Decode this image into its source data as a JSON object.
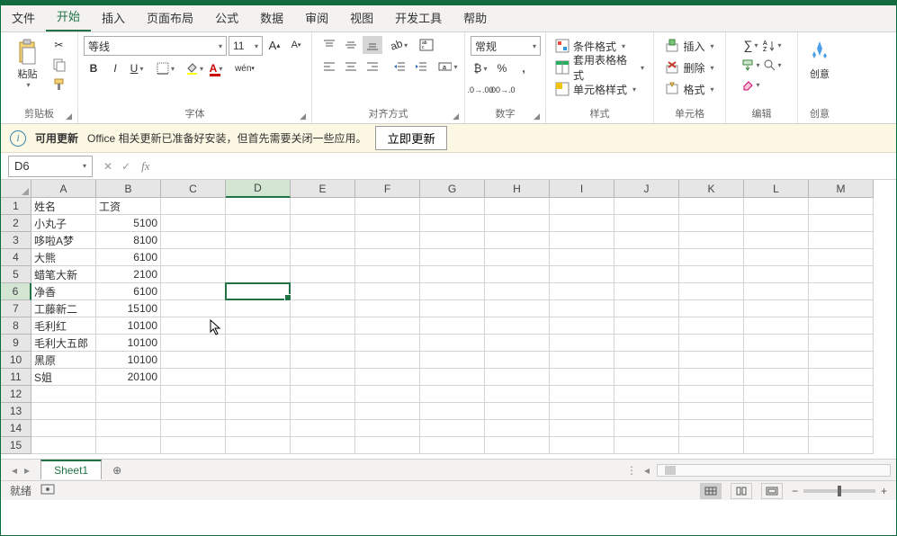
{
  "tabs": {
    "file": "文件",
    "home": "开始",
    "insert": "插入",
    "layout": "页面布局",
    "formulas": "公式",
    "data": "数据",
    "review": "审阅",
    "view": "视图",
    "dev": "开发工具",
    "help": "帮助"
  },
  "ribbon": {
    "clipboard": {
      "label": "剪贴板",
      "paste": "粘贴"
    },
    "font": {
      "label": "字体",
      "name": "等线",
      "size": "11"
    },
    "alignment": {
      "label": "对齐方式"
    },
    "number": {
      "label": "数字",
      "format": "常规"
    },
    "styles": {
      "label": "样式",
      "cond": "条件格式",
      "table": "套用表格格式",
      "cell": "单元格样式"
    },
    "cells": {
      "label": "单元格",
      "insert": "插入",
      "delete": "删除",
      "format": "格式"
    },
    "editing": {
      "label": "编辑"
    },
    "ideas": {
      "label": "创意"
    }
  },
  "msgbar": {
    "title": "可用更新",
    "text": "Office 相关更新已准备好安装，但首先需要关闭一些应用。",
    "button": "立即更新"
  },
  "namebox": "D6",
  "columns": [
    "A",
    "B",
    "C",
    "D",
    "E",
    "F",
    "G",
    "H",
    "I",
    "J",
    "K",
    "L",
    "M"
  ],
  "rowcount": 15,
  "sheet": {
    "headers": {
      "A": "姓名",
      "B": "工资"
    },
    "rows": [
      {
        "A": "小丸子",
        "B": 5100
      },
      {
        "A": "哆啦A梦",
        "B": 8100
      },
      {
        "A": "大熊",
        "B": 6100
      },
      {
        "A": "蜡笔大新",
        "B": 2100
      },
      {
        "A": "净香",
        "B": 6100
      },
      {
        "A": "工藤新二",
        "B": 15100
      },
      {
        "A": "毛利红",
        "B": 10100
      },
      {
        "A": "毛利大五郎",
        "B": 10100
      },
      {
        "A": "黑原",
        "B": 10100
      },
      {
        "A": "S姐",
        "B": 20100
      }
    ]
  },
  "activeCell": {
    "col": 3,
    "row": 6
  },
  "cursor": {
    "col": 2,
    "row": 8
  },
  "sheetTab": "Sheet1",
  "status": "就绪"
}
